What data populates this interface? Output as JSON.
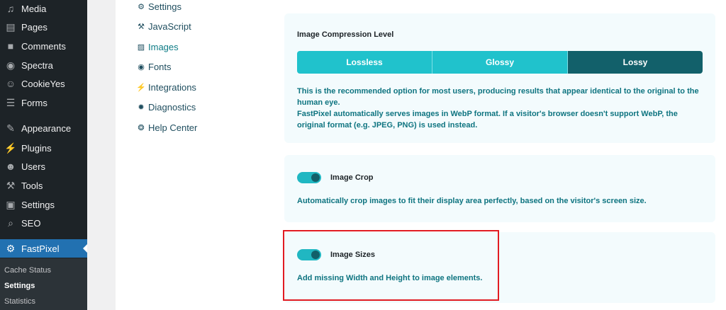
{
  "wp_menu": [
    {
      "label": "Media",
      "icon": "media-icon",
      "glyph": "♫"
    },
    {
      "label": "Pages",
      "icon": "pages-icon",
      "glyph": "▤"
    },
    {
      "label": "Comments",
      "icon": "comments-icon",
      "glyph": "■"
    },
    {
      "label": "Spectra",
      "icon": "spectra-icon",
      "glyph": "◉"
    },
    {
      "label": "CookieYes",
      "icon": "cookie-icon",
      "glyph": "☺"
    },
    {
      "label": "Forms",
      "icon": "forms-icon",
      "glyph": "☰"
    },
    {
      "label": "Appearance",
      "icon": "brush-icon",
      "glyph": "✎"
    },
    {
      "label": "Plugins",
      "icon": "plug-icon",
      "glyph": "⚡"
    },
    {
      "label": "Users",
      "icon": "user-icon",
      "glyph": "☻"
    },
    {
      "label": "Tools",
      "icon": "wrench-icon",
      "glyph": "⚒"
    },
    {
      "label": "Settings",
      "icon": "sliders-icon",
      "glyph": "▣"
    },
    {
      "label": "SEO",
      "icon": "search-icon",
      "glyph": "⌕"
    },
    {
      "label": "FastPixel",
      "icon": "fastpixel-icon",
      "glyph": "⚙"
    }
  ],
  "wp_submenu": [
    "Cache Status",
    "Settings",
    "Statistics"
  ],
  "plugin_nav": [
    {
      "label": "Settings",
      "icon": "gear-icon",
      "glyph": "⚙"
    },
    {
      "label": "JavaScript",
      "icon": "wrench-icon",
      "glyph": "⚒"
    },
    {
      "label": "Images",
      "icon": "image-icon",
      "glyph": "▨"
    },
    {
      "label": "Fonts",
      "icon": "eye-icon",
      "glyph": "◉"
    },
    {
      "label": "Integrations",
      "icon": "plug-icon",
      "glyph": "⚡"
    },
    {
      "label": "Diagnostics",
      "icon": "bug-icon",
      "glyph": "✹"
    },
    {
      "label": "Help Center",
      "icon": "lifebuoy-icon",
      "glyph": "❂"
    }
  ],
  "compression": {
    "title": "Image Compression Level",
    "options": [
      "Lossless",
      "Glossy",
      "Lossy"
    ],
    "selected": "Lossy",
    "desc_line1": "This is the recommended option for most users, producing results that appear identical to the original to the",
    "desc_line2": "human eye.",
    "desc_line3": "FastPixel automatically serves images in WebP format. If a visitor's browser doesn't support WebP, the",
    "desc_line4": "original format (e.g. JPEG, PNG) is used instead."
  },
  "crop": {
    "label": "Image Crop",
    "enabled": true,
    "desc": "Automatically crop images to fit their display area perfectly, based on the visitor's screen size."
  },
  "sizes": {
    "label": "Image Sizes",
    "enabled": true,
    "desc": "Add missing Width and Height to image elements."
  },
  "colors": {
    "sidebar_bg": "#1d2327",
    "active_menu": "#2271b1",
    "teal": "#20c2cc",
    "teal_dark": "#12606a",
    "text_teal": "#0e7480",
    "highlight": "#e11b22"
  }
}
